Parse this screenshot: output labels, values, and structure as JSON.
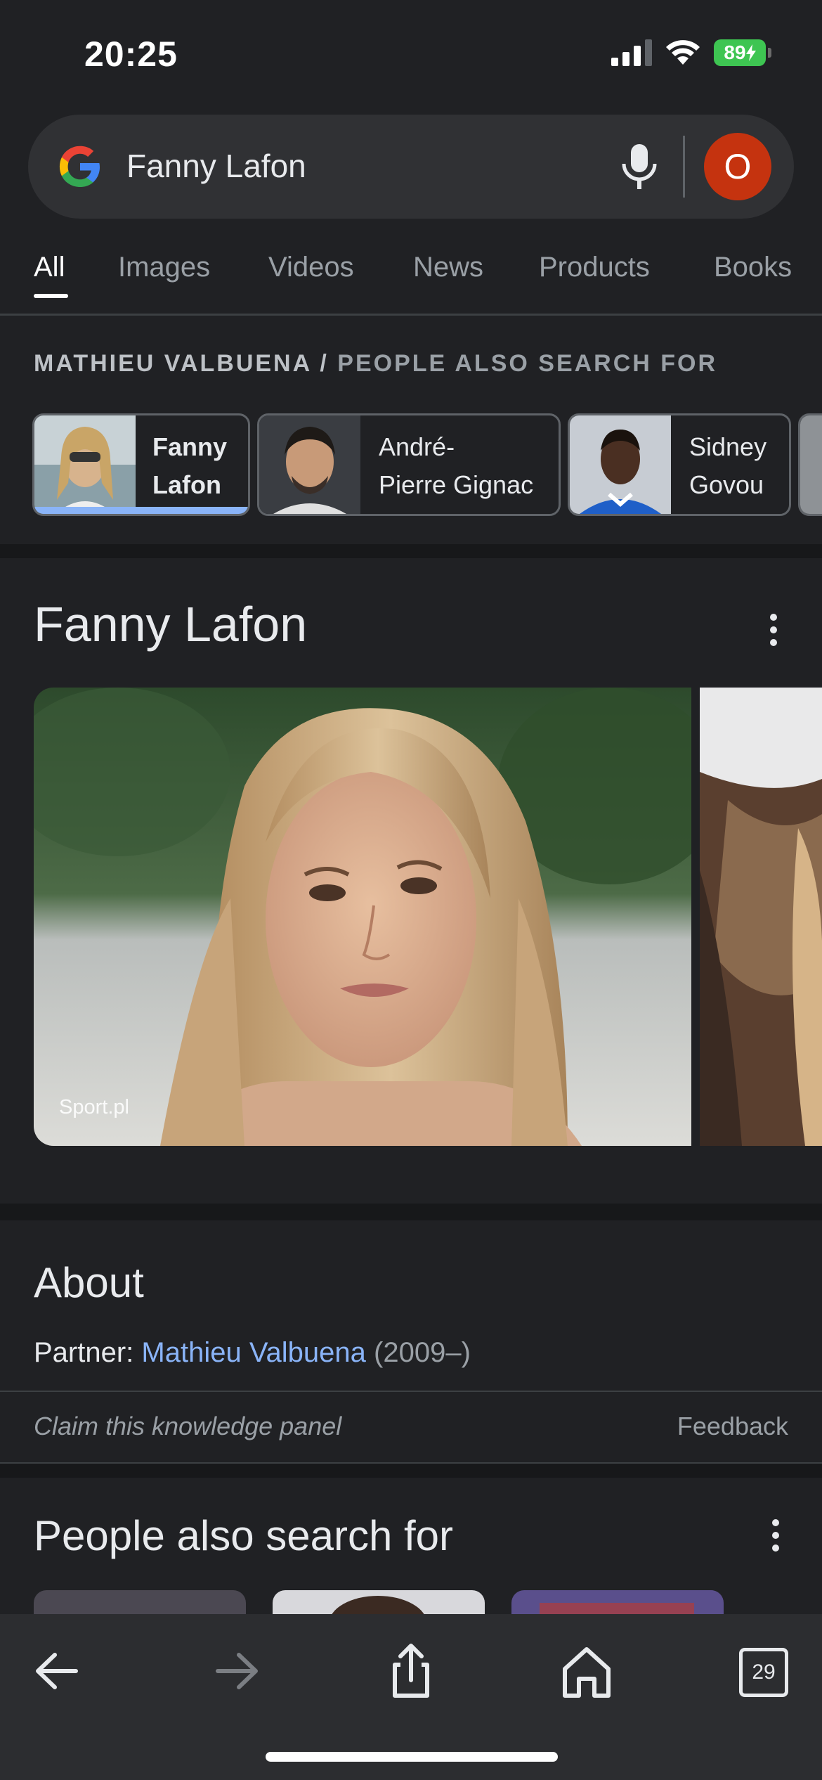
{
  "status_bar": {
    "time": "20:25",
    "battery": "89"
  },
  "search": {
    "query": "Fanny Lafon",
    "avatar_letter": "O"
  },
  "tabs": [
    "All",
    "Images",
    "Videos",
    "News",
    "Products",
    "Books"
  ],
  "breadcrumb": {
    "entity": "MATHIEU VALBUENA /",
    "section": "PEOPLE ALSO SEARCH FOR"
  },
  "chips": [
    {
      "line1": "Fanny",
      "line2": "Lafon"
    },
    {
      "line1": "André-",
      "line2": "Pierre Gignac"
    },
    {
      "line1": "Sidney",
      "line2": "Govou"
    }
  ],
  "knowledge_panel": {
    "title": "Fanny Lafon",
    "image_credit": "Sport.pl",
    "about_heading": "About",
    "partner_label": "Partner:",
    "partner_name": "Mathieu Valbuena",
    "partner_years": "(2009–)",
    "claim": "Claim this knowledge panel",
    "feedback": "Feedback"
  },
  "people_also_search": {
    "heading": "People also search for"
  },
  "toolbar": {
    "tabs_count": "29"
  }
}
